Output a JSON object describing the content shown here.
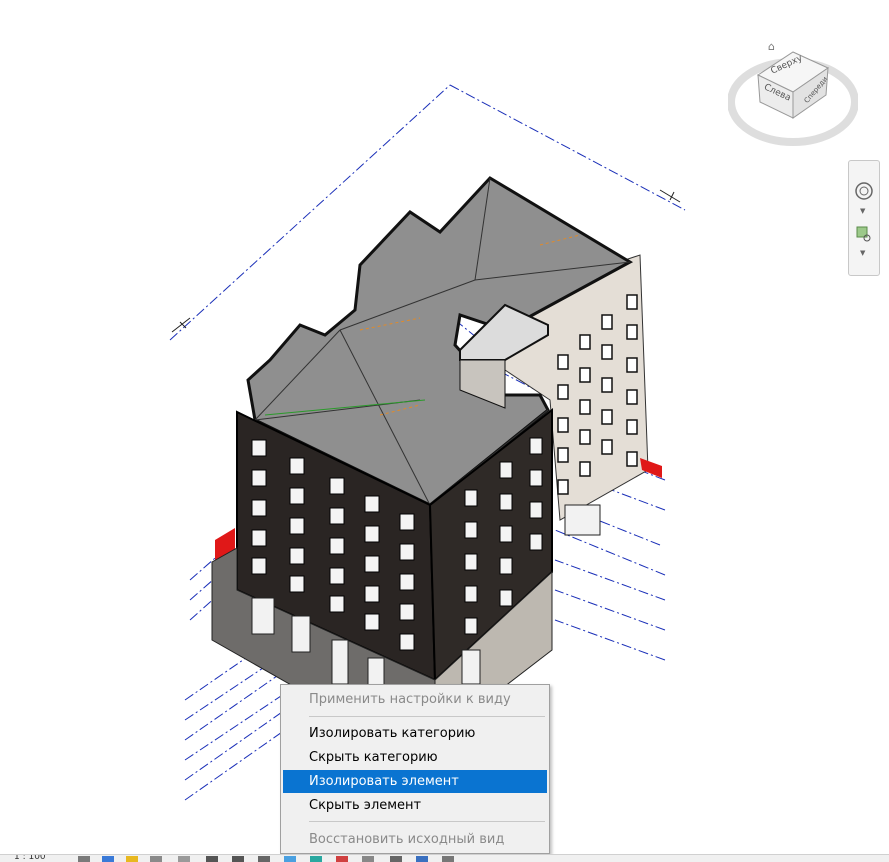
{
  "viewcube": {
    "top_label": "Сверху",
    "left_label": "Слева",
    "front_label": "Спереди"
  },
  "context_menu": {
    "items": [
      {
        "label": "Применить настройки к виду",
        "enabled": false
      },
      {
        "label": "Изолировать категорию",
        "enabled": true
      },
      {
        "label": "Скрыть категорию",
        "enabled": true
      },
      {
        "label": "Изолировать элемент",
        "enabled": true,
        "highlighted": true
      },
      {
        "label": "Скрыть элемент",
        "enabled": true
      },
      {
        "label": "Восстановить исходный вид",
        "enabled": false
      }
    ]
  },
  "status_bar": {
    "scale": "1 : 100"
  },
  "colors": {
    "menu_highlight": "#0a74d1",
    "gridline": "#1a2fb8",
    "facade_dark": "#2a2523",
    "facade_light": "#e4ded6",
    "roof": "#8f8f8f",
    "accent_red": "#e01818"
  }
}
